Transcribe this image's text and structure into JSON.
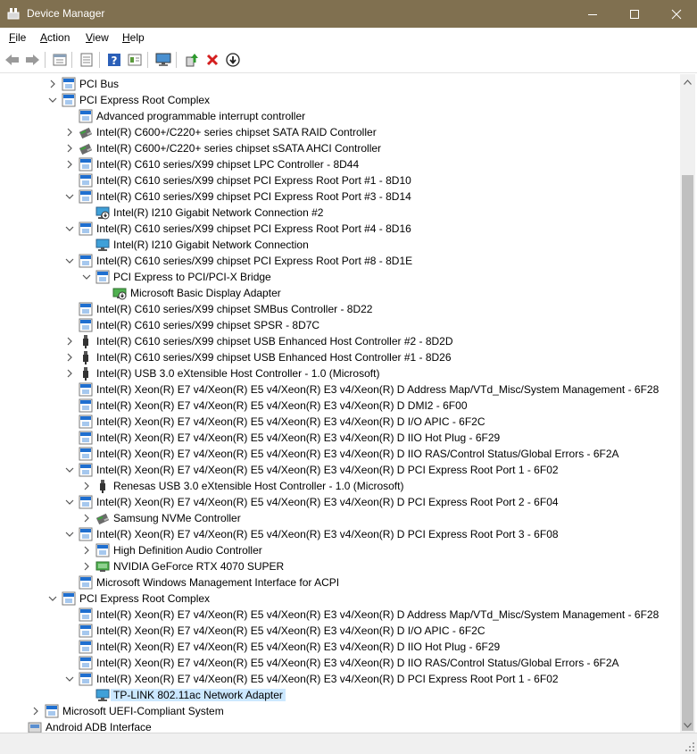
{
  "window": {
    "title": "Device Manager"
  },
  "menu": [
    {
      "label": "File",
      "accel": "F",
      "rest": "ile"
    },
    {
      "label": "Action",
      "accel": "A",
      "rest": "ction"
    },
    {
      "label": "View",
      "accel": "V",
      "rest": "iew"
    },
    {
      "label": "Help",
      "accel": "H",
      "rest": "elp"
    }
  ],
  "toolbar": [
    "back-icon",
    "forward-icon",
    "device-list-icon",
    "properties-icon",
    "help-icon",
    "view-resources-icon",
    "monitor-icon",
    "update-driver-icon",
    "uninstall-icon",
    "disable-device-icon"
  ],
  "colors": {
    "titlebar": "#807050",
    "selection": "#cce8ff"
  },
  "tree": [
    {
      "depth": 2,
      "exp": "collapsed",
      "icon": "device",
      "text": "PCI Bus"
    },
    {
      "depth": 2,
      "exp": "expanded",
      "icon": "device",
      "text": "PCI Express Root Complex"
    },
    {
      "depth": 3,
      "exp": "none",
      "icon": "device",
      "text": "Advanced programmable interrupt controller"
    },
    {
      "depth": 3,
      "exp": "collapsed",
      "icon": "storage",
      "text": "Intel(R) C600+/C220+ series chipset SATA RAID Controller"
    },
    {
      "depth": 3,
      "exp": "collapsed",
      "icon": "storage",
      "text": "Intel(R) C600+/C220+ series chipset sSATA AHCI Controller"
    },
    {
      "depth": 3,
      "exp": "collapsed",
      "icon": "device",
      "text": "Intel(R) C610 series/X99 chipset LPC Controller - 8D44"
    },
    {
      "depth": 3,
      "exp": "none",
      "icon": "device",
      "text": "Intel(R) C610 series/X99 chipset PCI Express Root Port #1 - 8D10"
    },
    {
      "depth": 3,
      "exp": "expanded",
      "icon": "device",
      "text": "Intel(R) C610 series/X99 chipset PCI Express Root Port #3 - 8D14"
    },
    {
      "depth": 4,
      "exp": "none",
      "icon": "network-disabled",
      "text": "Intel(R) I210 Gigabit Network Connection #2"
    },
    {
      "depth": 3,
      "exp": "expanded",
      "icon": "device",
      "text": "Intel(R) C610 series/X99 chipset PCI Express Root Port #4 - 8D16"
    },
    {
      "depth": 4,
      "exp": "none",
      "icon": "network",
      "text": "Intel(R) I210 Gigabit Network Connection"
    },
    {
      "depth": 3,
      "exp": "expanded",
      "icon": "device",
      "text": "Intel(R) C610 series/X99 chipset PCI Express Root Port #8 - 8D1E"
    },
    {
      "depth": 4,
      "exp": "expanded",
      "icon": "device",
      "text": "PCI Express to PCI/PCI-X Bridge"
    },
    {
      "depth": 5,
      "exp": "none",
      "icon": "display-disabled",
      "text": "Microsoft Basic Display Adapter"
    },
    {
      "depth": 3,
      "exp": "none",
      "icon": "device",
      "text": "Intel(R) C610 series/X99 chipset SMBus Controller - 8D22"
    },
    {
      "depth": 3,
      "exp": "none",
      "icon": "device",
      "text": "Intel(R) C610 series/X99 chipset SPSR - 8D7C"
    },
    {
      "depth": 3,
      "exp": "collapsed",
      "icon": "usb",
      "text": "Intel(R) C610 series/X99 chipset USB Enhanced Host Controller #2 - 8D2D"
    },
    {
      "depth": 3,
      "exp": "collapsed",
      "icon": "usb",
      "text": "Intel(R) C610 series/X99 chipset USB Enhanced Host Controller #1 - 8D26"
    },
    {
      "depth": 3,
      "exp": "collapsed",
      "icon": "usb",
      "text": "Intel(R) USB 3.0 eXtensible Host Controller - 1.0 (Microsoft)"
    },
    {
      "depth": 3,
      "exp": "none",
      "icon": "device",
      "text": "Intel(R) Xeon(R) E7 v4/Xeon(R) E5 v4/Xeon(R) E3 v4/Xeon(R) D Address Map/VTd_Misc/System Management - 6F28"
    },
    {
      "depth": 3,
      "exp": "none",
      "icon": "device",
      "text": "Intel(R) Xeon(R) E7 v4/Xeon(R) E5 v4/Xeon(R) E3 v4/Xeon(R) D DMI2 - 6F00"
    },
    {
      "depth": 3,
      "exp": "none",
      "icon": "device",
      "text": "Intel(R) Xeon(R) E7 v4/Xeon(R) E5 v4/Xeon(R) E3 v4/Xeon(R) D I/O APIC - 6F2C"
    },
    {
      "depth": 3,
      "exp": "none",
      "icon": "device",
      "text": "Intel(R) Xeon(R) E7 v4/Xeon(R) E5 v4/Xeon(R) E3 v4/Xeon(R) D IIO Hot Plug - 6F29"
    },
    {
      "depth": 3,
      "exp": "none",
      "icon": "device",
      "text": "Intel(R) Xeon(R) E7 v4/Xeon(R) E5 v4/Xeon(R) E3 v4/Xeon(R) D IIO RAS/Control Status/Global Errors - 6F2A"
    },
    {
      "depth": 3,
      "exp": "expanded",
      "icon": "device",
      "text": "Intel(R) Xeon(R) E7 v4/Xeon(R) E5 v4/Xeon(R) E3 v4/Xeon(R) D PCI Express Root Port 1 - 6F02"
    },
    {
      "depth": 4,
      "exp": "collapsed",
      "icon": "usb",
      "text": "Renesas USB 3.0 eXtensible Host Controller - 1.0 (Microsoft)"
    },
    {
      "depth": 3,
      "exp": "expanded",
      "icon": "device",
      "text": "Intel(R) Xeon(R) E7 v4/Xeon(R) E5 v4/Xeon(R) E3 v4/Xeon(R) D PCI Express Root Port 2 - 6F04"
    },
    {
      "depth": 4,
      "exp": "collapsed",
      "icon": "storage",
      "text": "Samsung NVMe Controller"
    },
    {
      "depth": 3,
      "exp": "expanded",
      "icon": "device",
      "text": "Intel(R) Xeon(R) E7 v4/Xeon(R) E5 v4/Xeon(R) E3 v4/Xeon(R) D PCI Express Root Port 3 - 6F08"
    },
    {
      "depth": 4,
      "exp": "collapsed",
      "icon": "device",
      "text": "High Definition Audio Controller"
    },
    {
      "depth": 4,
      "exp": "collapsed",
      "icon": "display",
      "text": "NVIDIA GeForce RTX 4070 SUPER"
    },
    {
      "depth": 3,
      "exp": "none",
      "icon": "device",
      "text": "Microsoft Windows Management Interface for ACPI"
    },
    {
      "depth": 2,
      "exp": "expanded",
      "icon": "device",
      "text": "PCI Express Root Complex"
    },
    {
      "depth": 3,
      "exp": "none",
      "icon": "device",
      "text": "Intel(R) Xeon(R) E7 v4/Xeon(R) E5 v4/Xeon(R) E3 v4/Xeon(R) D Address Map/VTd_Misc/System Management - 6F28"
    },
    {
      "depth": 3,
      "exp": "none",
      "icon": "device",
      "text": "Intel(R) Xeon(R) E7 v4/Xeon(R) E5 v4/Xeon(R) E3 v4/Xeon(R) D I/O APIC - 6F2C"
    },
    {
      "depth": 3,
      "exp": "none",
      "icon": "device",
      "text": "Intel(R) Xeon(R) E7 v4/Xeon(R) E5 v4/Xeon(R) E3 v4/Xeon(R) D IIO Hot Plug - 6F29"
    },
    {
      "depth": 3,
      "exp": "none",
      "icon": "device",
      "text": "Intel(R) Xeon(R) E7 v4/Xeon(R) E5 v4/Xeon(R) E3 v4/Xeon(R) D IIO RAS/Control Status/Global Errors - 6F2A"
    },
    {
      "depth": 3,
      "exp": "expanded",
      "icon": "device",
      "text": "Intel(R) Xeon(R) E7 v4/Xeon(R) E5 v4/Xeon(R) E3 v4/Xeon(R) D PCI Express Root Port 1 - 6F02"
    },
    {
      "depth": 4,
      "exp": "none",
      "icon": "network",
      "text": "TP-LINK 802.11ac Network Adapter",
      "selected": true
    },
    {
      "depth": 1,
      "exp": "collapsed",
      "icon": "device",
      "text": "Microsoft UEFI-Compliant System"
    },
    {
      "depth": 0,
      "exp": "none",
      "icon": "adb",
      "text": "Android ADB Interface"
    }
  ]
}
